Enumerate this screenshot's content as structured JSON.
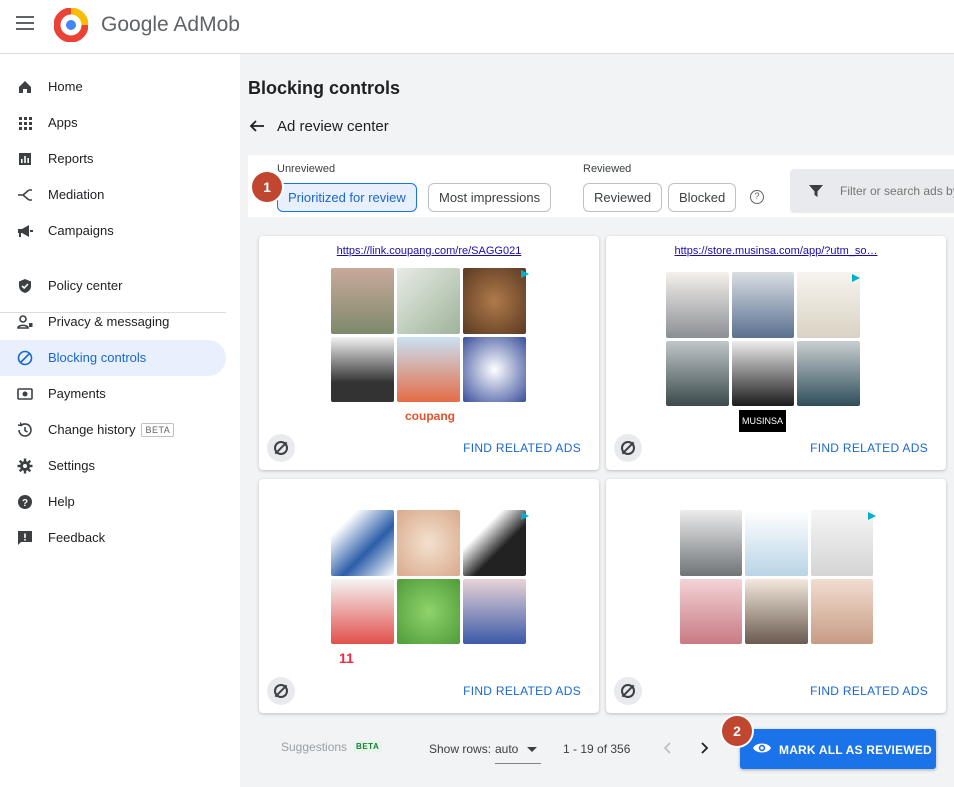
{
  "app": {
    "title": "Google AdMob"
  },
  "sidebar": {
    "items": [
      {
        "label": "Home",
        "icon": "home-icon"
      },
      {
        "label": "Apps",
        "icon": "apps-grid-icon"
      },
      {
        "label": "Reports",
        "icon": "reports-icon"
      },
      {
        "label": "Mediation",
        "icon": "mediation-icon"
      },
      {
        "label": "Campaigns",
        "icon": "megaphone-icon"
      },
      {
        "label": "Policy center",
        "icon": "shield-icon"
      },
      {
        "label": "Privacy & messaging",
        "icon": "privacy-icon"
      },
      {
        "label": "Blocking controls",
        "icon": "block-icon",
        "active": true
      },
      {
        "label": "Payments",
        "icon": "payments-icon"
      },
      {
        "label": "Change history",
        "icon": "history-icon",
        "badge": "BETA"
      },
      {
        "label": "Settings",
        "icon": "gear-icon"
      },
      {
        "label": "Help",
        "icon": "help-icon"
      },
      {
        "label": "Feedback",
        "icon": "feedback-icon"
      }
    ]
  },
  "page": {
    "title": "Blocking controls",
    "subtitle": "Ad review center"
  },
  "filters": {
    "unreviewed_label": "Unreviewed",
    "reviewed_label": "Reviewed",
    "chips": {
      "prioritized": "Prioritized for review",
      "most_impressions": "Most impressions",
      "reviewed": "Reviewed",
      "blocked": "Blocked"
    },
    "help_symbol": "?",
    "search_placeholder": "Filter or search ads by"
  },
  "annotations": {
    "step1": "1",
    "step2": "2"
  },
  "ads": [
    {
      "url": "https://link.coupang.com/re/SAGG021",
      "brand": "coupang",
      "brand_color": "#e0532b",
      "action": "FIND RELATED ADS"
    },
    {
      "url": "https://store.musinsa.com/app/?utm_so…",
      "brand": "MUSINSA",
      "brand_color": "#000000",
      "action": "FIND RELATED ADS"
    },
    {
      "url": "",
      "brand": "11",
      "brand_color": "#ee2a3b",
      "action": "FIND RELATED ADS"
    },
    {
      "url": "",
      "brand": "",
      "brand_color": "",
      "action": "FIND RELATED ADS"
    }
  ],
  "footer": {
    "suggestions": "Suggestions",
    "suggestions_badge": "BETA",
    "show_rows_label": "Show rows:",
    "rows_value": "auto",
    "range": "1 - 19 of 356",
    "mark_all": "MARK ALL AS REVIEWED"
  },
  "colors": {
    "accent": "#1a73e8",
    "badge": "#c0462f",
    "active_bg": "#e8f0fe"
  }
}
